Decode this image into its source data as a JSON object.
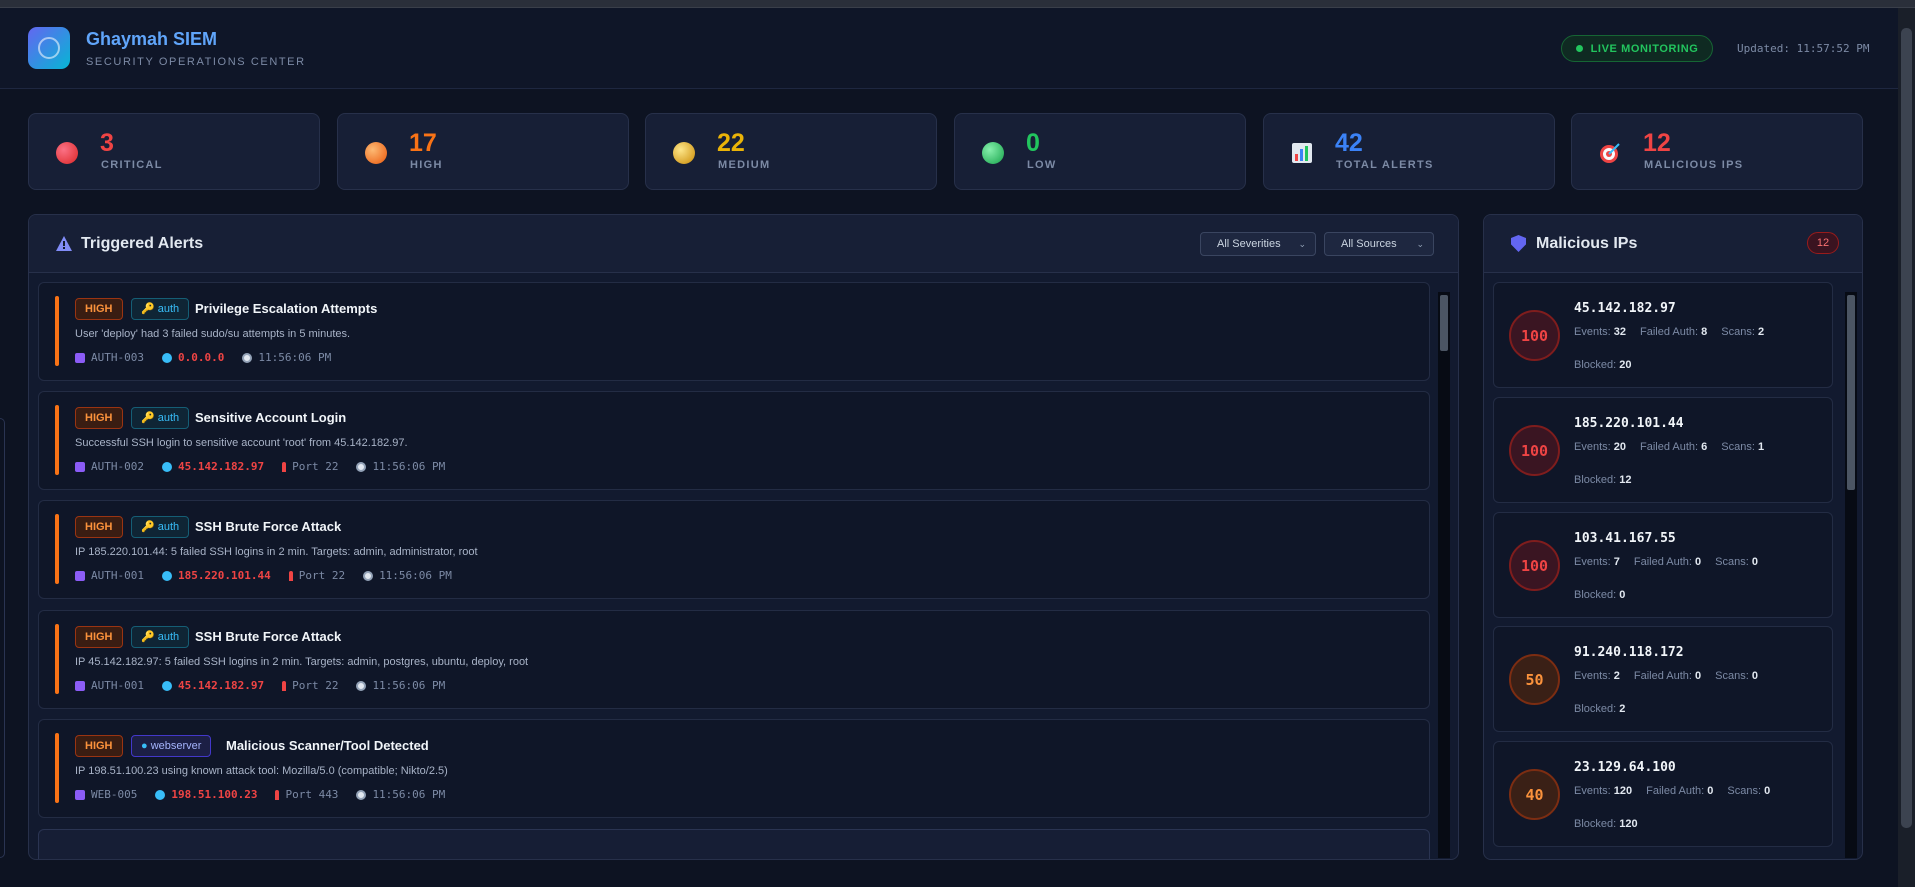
{
  "header": {
    "title": "Ghaymah SIEM",
    "subtitle": "SECURITY OPERATIONS CENTER",
    "live_label": "LIVE MONITORING",
    "updated": "Updated: 11:57:52 PM"
  },
  "stats": [
    {
      "value": "3",
      "label": "CRITICAL",
      "color": "#ef4444"
    },
    {
      "value": "17",
      "label": "HIGH",
      "color": "#f97316"
    },
    {
      "value": "22",
      "label": "MEDIUM",
      "color": "#eab308"
    },
    {
      "value": "0",
      "label": "LOW",
      "color": "#22c55e"
    },
    {
      "value": "42",
      "label": "TOTAL ALERTS",
      "color": "#3b82f6"
    },
    {
      "value": "12",
      "label": "MALICIOUS IPS",
      "color": "#ef4444"
    }
  ],
  "alerts_panel": {
    "title": "Triggered Alerts",
    "filter_severity": "All Severities",
    "filter_source": "All Sources",
    "alerts": [
      {
        "severity": "HIGH",
        "source": "auth",
        "title": "Privilege Escalation Attempts",
        "description": "User 'deploy' had 3 failed sudo/su attempts in 5 minutes.",
        "rule": "AUTH-003",
        "ip": "0.0.0.0",
        "port": "",
        "time": "11:56:06 PM"
      },
      {
        "severity": "HIGH",
        "source": "auth",
        "title": "Sensitive Account Login",
        "description": "Successful SSH login to sensitive account 'root' from 45.142.182.97.",
        "rule": "AUTH-002",
        "ip": "45.142.182.97",
        "port": "Port 22",
        "time": "11:56:06 PM"
      },
      {
        "severity": "HIGH",
        "source": "auth",
        "title": "SSH Brute Force Attack",
        "description": "IP 185.220.101.44: 5 failed SSH logins in 2 min. Targets: admin, administrator, root",
        "rule": "AUTH-001",
        "ip": "185.220.101.44",
        "port": "Port 22",
        "time": "11:56:06 PM"
      },
      {
        "severity": "HIGH",
        "source": "auth",
        "title": "SSH Brute Force Attack",
        "description": "IP 45.142.182.97: 5 failed SSH logins in 2 min. Targets: admin, postgres, ubuntu, deploy, root",
        "rule": "AUTH-001",
        "ip": "45.142.182.97",
        "port": "Port 22",
        "time": "11:56:06 PM"
      },
      {
        "severity": "HIGH",
        "source": "webserver",
        "title": "Malicious Scanner/Tool Detected",
        "description": "IP 198.51.100.23 using known attack tool: Mozilla/5.0 (compatible; Nikto/2.5)",
        "rule": "WEB-005",
        "ip": "198.51.100.23",
        "port": "Port 443",
        "time": "11:56:06 PM"
      }
    ]
  },
  "ips_panel": {
    "title": "Malicious IPs",
    "count": "12",
    "labels": {
      "events": "Events:",
      "failed": "Failed Auth:",
      "scans": "Scans:",
      "blocked": "Blocked:"
    },
    "ips": [
      {
        "ip": "45.142.182.97",
        "score": "100",
        "events": "32",
        "failed": "8",
        "scans": "2",
        "blocked": "20"
      },
      {
        "ip": "185.220.101.44",
        "score": "100",
        "events": "20",
        "failed": "6",
        "scans": "1",
        "blocked": "12"
      },
      {
        "ip": "103.41.167.55",
        "score": "100",
        "events": "7",
        "failed": "0",
        "scans": "0",
        "blocked": "0"
      },
      {
        "ip": "91.240.118.172",
        "score": "50",
        "events": "2",
        "failed": "0",
        "scans": "0",
        "blocked": "2"
      },
      {
        "ip": "23.129.64.100",
        "score": "40",
        "events": "120",
        "failed": "0",
        "scans": "0",
        "blocked": "120"
      }
    ]
  }
}
